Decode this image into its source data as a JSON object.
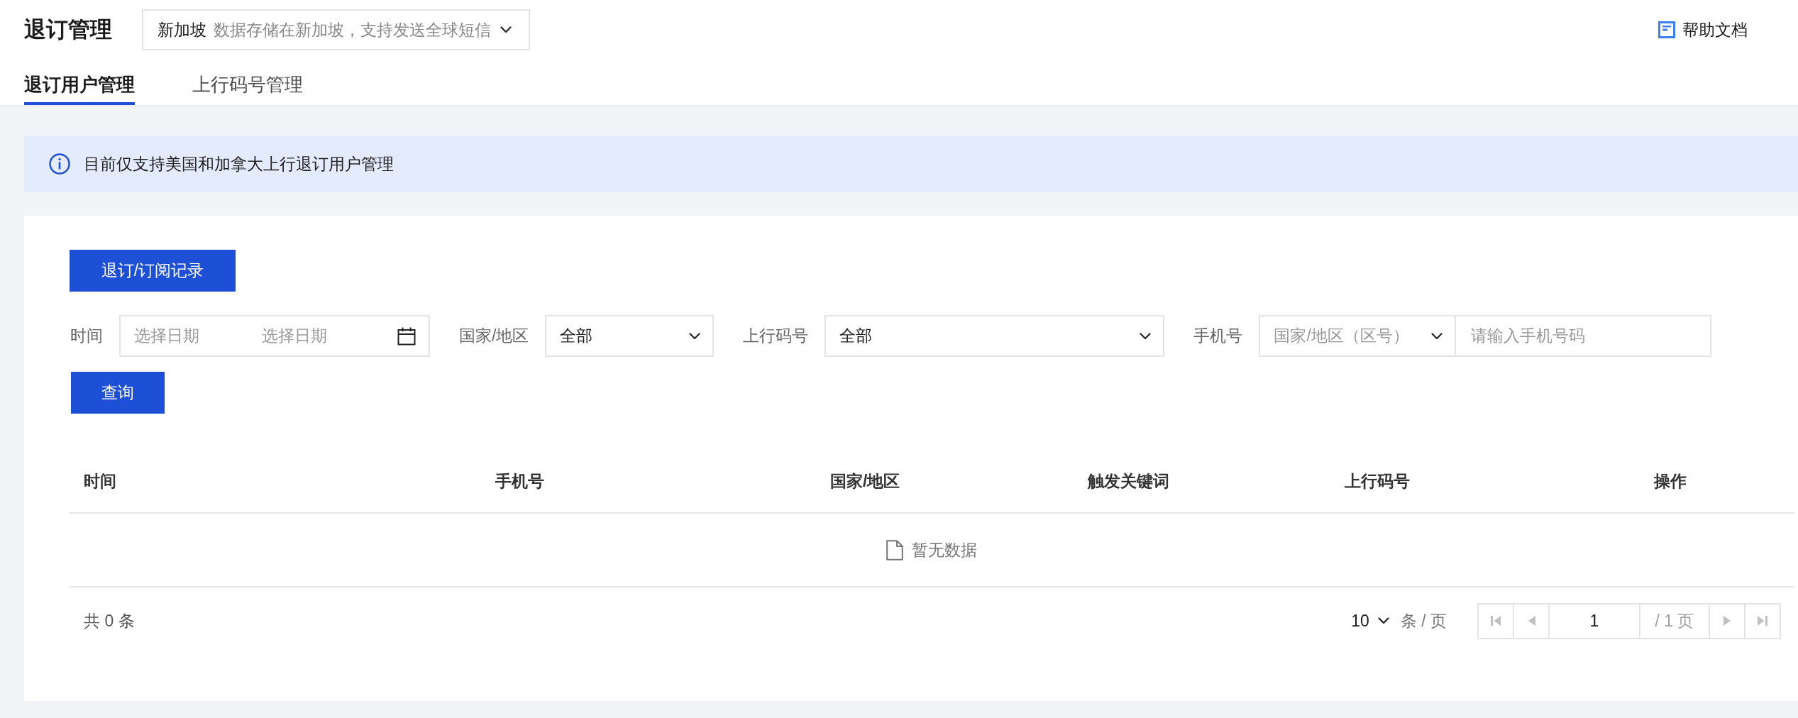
{
  "page_header": {
    "title": "退订管理",
    "region_select": {
      "value": "新加坡",
      "description": "数据存储在新加坡，支持发送全球短信"
    },
    "help_link": "帮助文档"
  },
  "tabs": [
    {
      "label": "退订用户管理",
      "selected": true
    },
    {
      "label": "上行码号管理",
      "selected": false
    }
  ],
  "notice": "目前仅支持美国和加拿大上行退订用户管理",
  "records_button": "退订/订阅记录",
  "filters": [
    {
      "kind": "date_range",
      "label": "时间",
      "start": {
        "placeholder": "选择日期"
      },
      "end": {
        "placeholder": "选择日期"
      }
    },
    {
      "kind": "select",
      "label": "国家/地区",
      "value": "全部"
    },
    {
      "kind": "select",
      "label": "上行码号",
      "value": "全部"
    },
    {
      "kind": "phone",
      "label": "手机号",
      "country_select": {
        "placeholder": "国家/地区（区号）"
      },
      "input": {
        "placeholder": "请输入手机号码"
      }
    }
  ],
  "query_button": "查询",
  "table": {
    "columns": [
      "时间",
      "手机号",
      "国家/地区",
      "触发关键词",
      "上行码号",
      "操作"
    ],
    "empty_text": "暂无数据"
  },
  "pagination": {
    "total": "共 0 条",
    "page_size": "10",
    "page_size_unit": "条 / 页",
    "current_page": "1",
    "page_count": "/ 1 页",
    "nav_buttons": [
      {
        "kind": "first",
        "disabled": true
      },
      {
        "kind": "prev",
        "disabled": true
      },
      {
        "kind": "next",
        "disabled": true
      },
      {
        "kind": "last",
        "disabled": true
      }
    ]
  }
}
